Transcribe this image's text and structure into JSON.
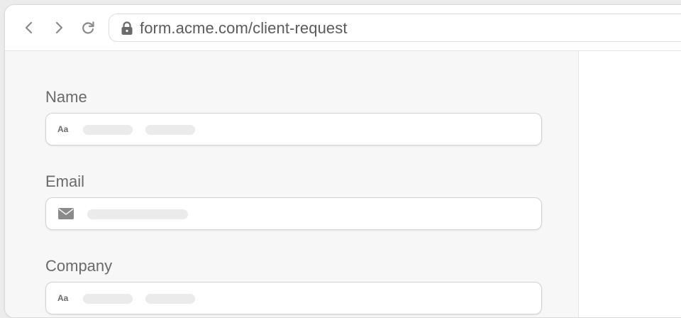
{
  "browser": {
    "url": "form.acme.com/client-request",
    "icons": {
      "back": "chevron-left-icon",
      "forward": "chevron-right-icon",
      "reload": "reload-icon",
      "secure": "lock-icon"
    }
  },
  "form": {
    "fields": [
      {
        "label": "Name",
        "icon": "text-format-icon",
        "icon_text": "Aa",
        "value": ""
      },
      {
        "label": "Email",
        "icon": "mail-icon",
        "value": ""
      },
      {
        "label": "Company",
        "icon": "text-format-icon",
        "icon_text": "Aa",
        "value": ""
      }
    ]
  },
  "colors": {
    "page_background": "#f7f7f7",
    "input_background": "#ffffff",
    "label_text": "#6a6a6a",
    "placeholder_bar": "#ebebeb"
  }
}
